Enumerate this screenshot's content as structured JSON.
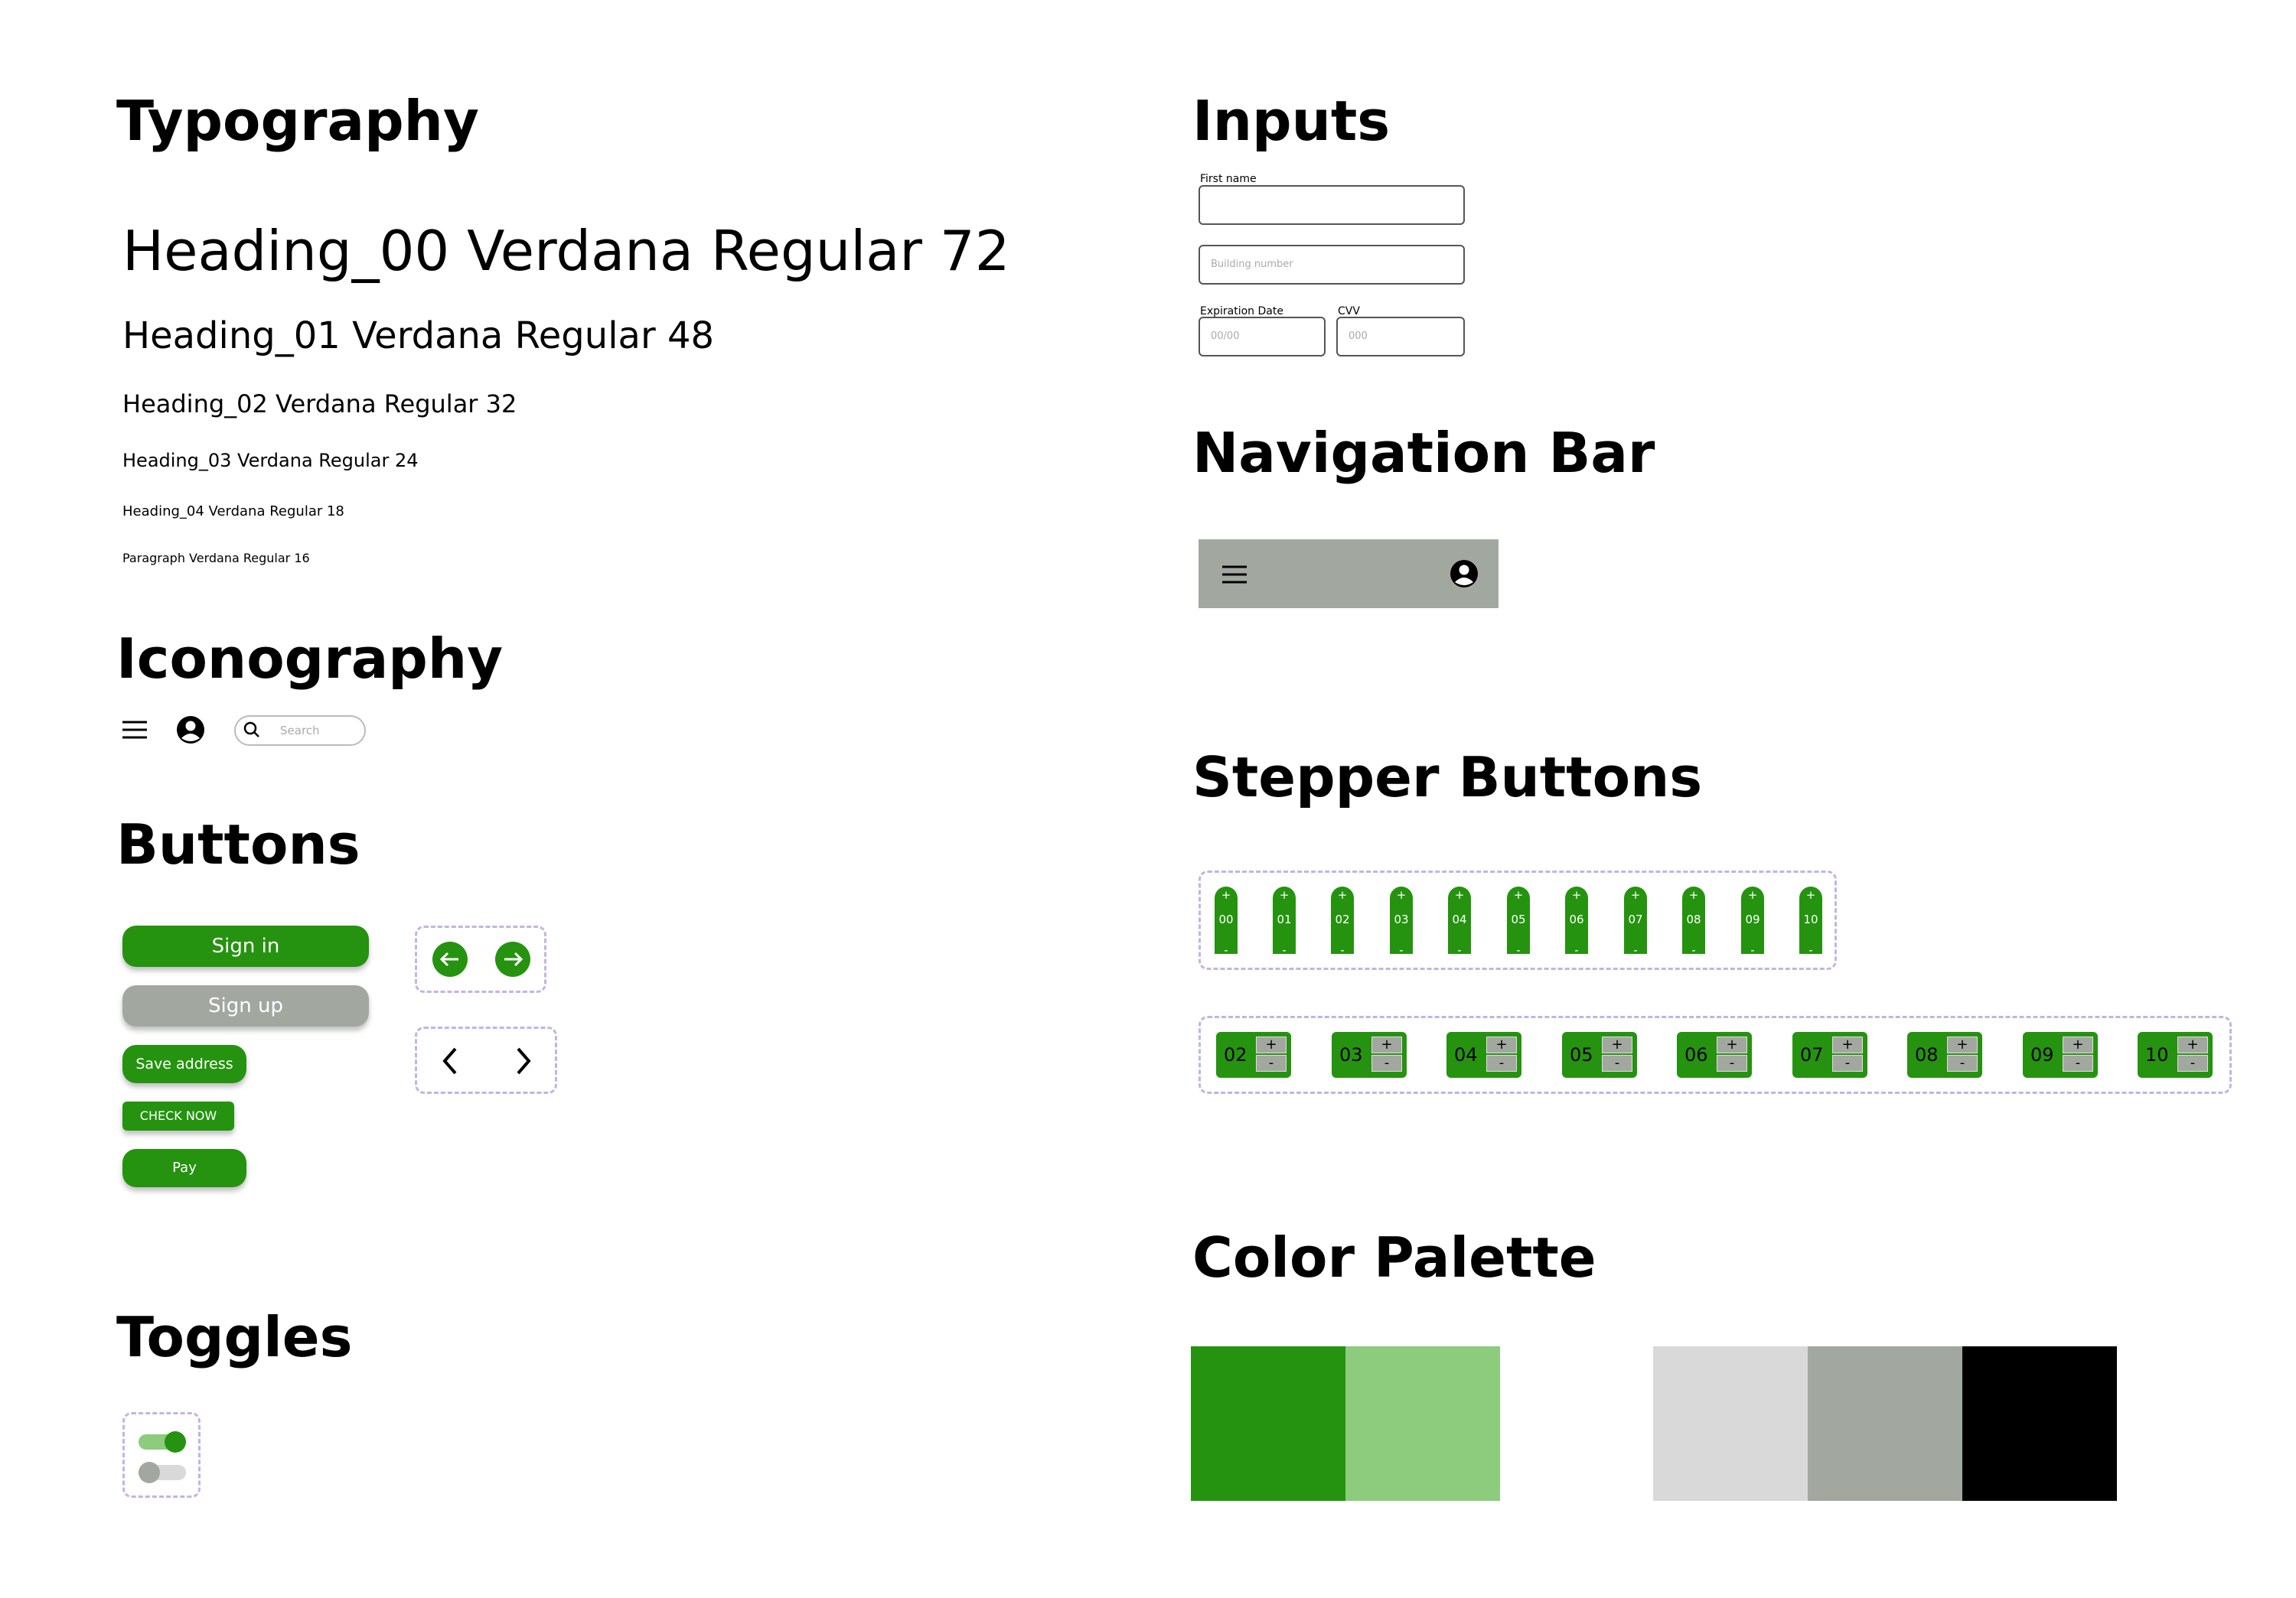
{
  "sections": {
    "typography": "Typography",
    "iconography": "Iconography",
    "buttons": "Buttons",
    "toggles": "Toggles",
    "inputs": "Inputs",
    "navigation_bar": "Navigation Bar",
    "stepper_buttons": "Stepper Buttons",
    "color_palette": "Color Palette"
  },
  "typography": {
    "h00": "Heading_00 Verdana Regular 72",
    "h01": "Heading_01 Verdana Regular 48",
    "h02": "Heading_02 Verdana Regular 32",
    "h03": "Heading_03 Verdana Regular 24",
    "h04": "Heading_04 Verdana Regular 18",
    "paragraph": "Paragraph Verdana Regular 16"
  },
  "iconography": {
    "icons": [
      "menu-icon",
      "account-icon",
      "search-icon"
    ],
    "search_placeholder": "Search"
  },
  "buttons": {
    "sign_in": "Sign in",
    "sign_up": "Sign up",
    "save_address": "Save address",
    "check_now": "CHECK NOW",
    "pay": "Pay",
    "arrow_buttons": [
      "arrow-left-icon",
      "arrow-right-icon"
    ],
    "chevron_buttons": [
      "chevron-left-icon",
      "chevron-right-icon"
    ]
  },
  "toggles": [
    {
      "state": "on"
    },
    {
      "state": "off"
    }
  ],
  "inputs": {
    "first_name_label": "First name",
    "first_name_value": "",
    "building_placeholder": "Building number",
    "expiration_label": "Expiration Date",
    "expiration_placeholder": "00/00",
    "cvv_label": "CVV",
    "cvv_placeholder": "000"
  },
  "navigation_bar": {
    "icons": [
      "menu-icon",
      "account-icon"
    ],
    "background": "#a2a8a0"
  },
  "stepper_buttons": {
    "vertical": [
      "00",
      "01",
      "02",
      "03",
      "04",
      "05",
      "06",
      "07",
      "08",
      "09",
      "10"
    ],
    "horizontal": [
      "02",
      "03",
      "04",
      "05",
      "06",
      "07",
      "08",
      "09",
      "10"
    ],
    "plus": "+",
    "minus": "-"
  },
  "colors": {
    "primary_green": "#25930f",
    "light_green": "#8dcb7d",
    "light_grey": "#d9d9d9",
    "mid_grey": "#a2a8a0",
    "black": "#000000"
  },
  "color_palette": [
    "#25930f",
    "#8dcb7d",
    "#d9d9d9",
    "#a2a8a0",
    "#000000"
  ]
}
